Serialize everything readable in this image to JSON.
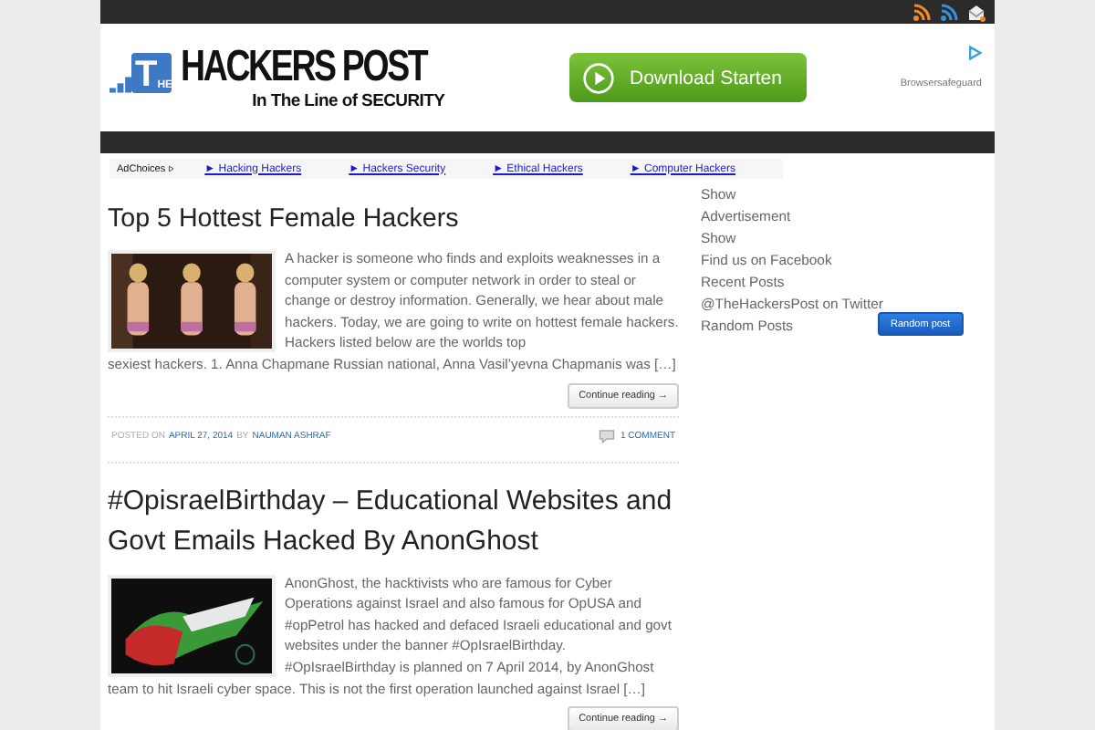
{
  "logo": {
    "badge_big": "T",
    "badge_small": "HE",
    "name": "HACKERS POST",
    "tagline": "In The Line of SECURITY"
  },
  "header_ad": {
    "button": "Download Starten",
    "sponsor": "Browsersafeguard"
  },
  "ad_links": {
    "label": "AdChoices",
    "links": [
      "► Hacking Hackers",
      "► Hackers Security",
      "► Ethical Hackers",
      "► Computer Hackers"
    ]
  },
  "posts": [
    {
      "title": "Top 5 Hottest Female Hackers",
      "excerpt": "A hacker is someone who finds and exploits weaknesses in a computer system or computer network in order to steal or change or destroy information. Generally, we hear about male hackers. Today, we are going to write on hottest female hackers. Hackers listed below are the worlds top",
      "excerpt_below": "sexiest hackers. 1. Anna Chapmane Russian national, Anna Vasil’yevna Chapmanis was […]",
      "button": "Continue reading →",
      "meta": {
        "posted_on": "POSTED ON",
        "date": "APRIL 27, 2014",
        "by": "BY",
        "author": "NAUMAN ASHRAF",
        "comments": "1 COMMENT"
      }
    },
    {
      "title": "#OpisraelBirthday – Educational Websites and Govt Emails Hacked By AnonGhost",
      "excerpt": "AnonGhost, the hacktivists who are famous for Cyber Operations against Israel and also famous for OpUSA and #opPetrol has hacked and defaced Israeli educational and govt websites under the banner #OpIsraelBirthday. #OpIsraelBirthday is planned on 7 April 2014, by AnonGhost",
      "excerpt_below": "team to hit Israeli cyber space. This is not the first operation launched against Israel […]",
      "button": "Continue reading →"
    }
  ],
  "sidebar": {
    "items": [
      "Show",
      "Advertisement",
      "Show",
      "Find us on Facebook",
      "Recent Posts",
      "@TheHackersPost on Twitter",
      "Random Posts"
    ],
    "button": "Random post"
  }
}
